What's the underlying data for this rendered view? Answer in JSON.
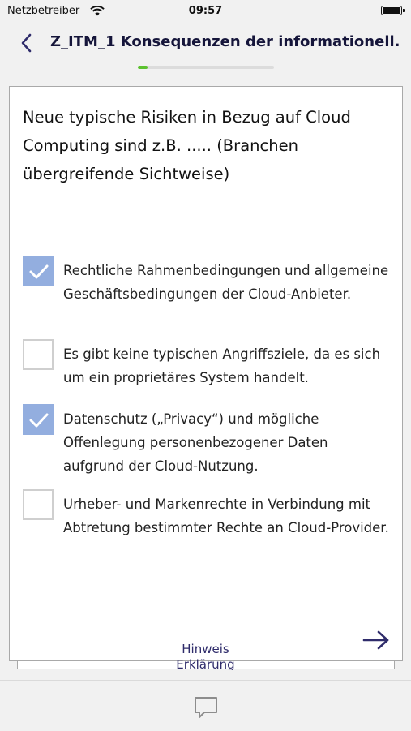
{
  "status_bar": {
    "carrier": "Netzbetreiber",
    "time": "09:57"
  },
  "nav": {
    "title": "Z_ITM_1 Konsequenzen der informationell..."
  },
  "progress": {
    "value": 0.07,
    "color": "#5cc230"
  },
  "question": "Neue typische Risiken in Bezug auf Cloud Computing sind z.B. ..... (Branchen übergreifende Sichtweise)",
  "options": [
    {
      "label": "Rechtliche Rahmenbedingungen und allgemeine Geschäftsbedingungen der Cloud-Anbieter.",
      "checked": true
    },
    {
      "label": "Es gibt keine typischen Angriffsziele, da es sich um ein proprietäres System handelt.",
      "checked": false
    },
    {
      "label": "Datenschutz („Privacy“) und mögliche Offenlegung personenbezogener Daten aufgrund der Cloud-Nutzung.",
      "checked": true
    },
    {
      "label": "Urheber- und Markenrechte in Verbindung mit Abtretung bestimmter Rechte an Cloud-Provider.",
      "checked": false
    }
  ],
  "footer": {
    "hint_label": "Hinweis",
    "explanation_label": "Erklärung"
  },
  "colors": {
    "accent": "#2f2c6b",
    "checkbox_checked": "#93aedf"
  },
  "icons": {
    "back": "chevron-left-icon",
    "next": "arrow-right-icon",
    "comment": "comment-icon",
    "wifi": "wifi-icon",
    "battery": "battery-icon"
  }
}
